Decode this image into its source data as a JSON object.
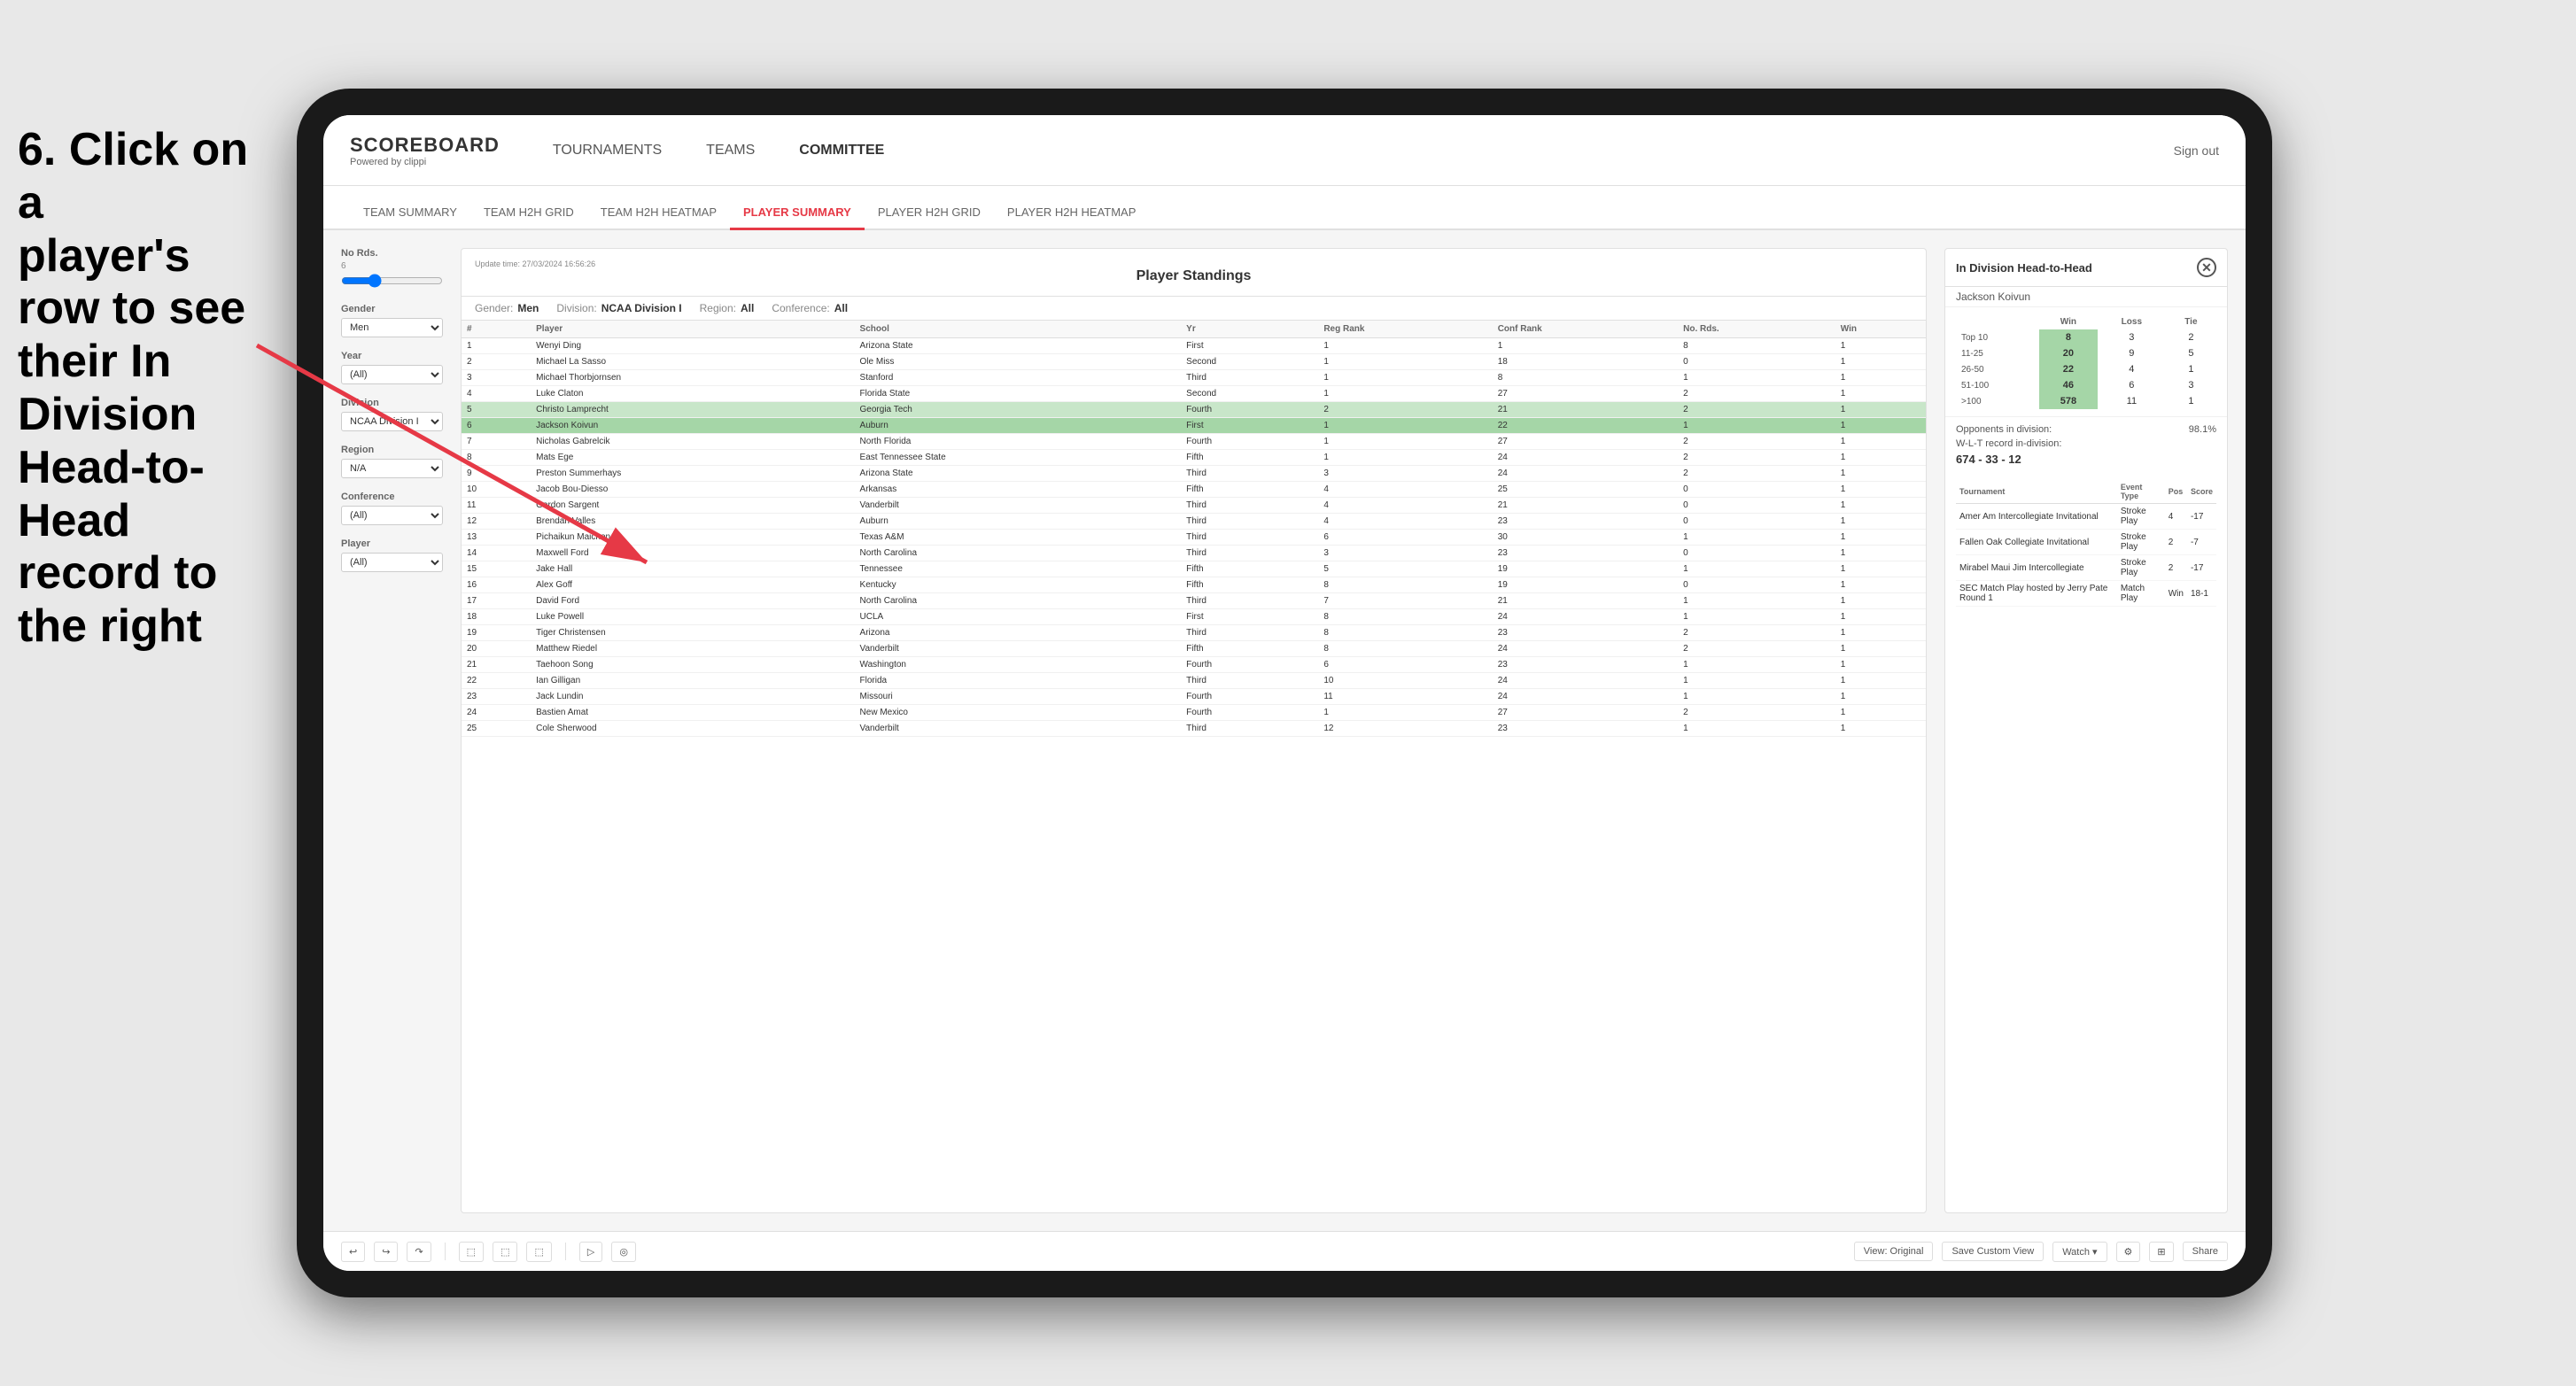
{
  "instruction": {
    "line1": "6. Click on a",
    "line2": "player's row to see",
    "line3": "their In Division",
    "line4": "Head-to-Head",
    "line5": "record to the right"
  },
  "nav": {
    "logo": "SCOREBOARD",
    "logo_sub": "Powered by clippi",
    "items": [
      "TOURNAMENTS",
      "TEAMS",
      "COMMITTEE"
    ],
    "sign_out": "Sign out"
  },
  "sub_nav": {
    "items": [
      "TEAM SUMMARY",
      "TEAM H2H GRID",
      "TEAM H2H HEATMAP",
      "PLAYER SUMMARY",
      "PLAYER H2H GRID",
      "PLAYER H2H HEATMAP"
    ],
    "active": "PLAYER SUMMARY"
  },
  "standings": {
    "title": "Player Standings",
    "update_time": "Update time:",
    "update_date": "27/03/2024 16:56:26",
    "filters": {
      "gender_label": "Gender:",
      "gender_value": "Men",
      "division_label": "Division:",
      "division_value": "NCAA Division I",
      "region_label": "Region:",
      "region_value": "All",
      "conference_label": "Conference:",
      "conference_value": "All"
    },
    "columns": [
      "#",
      "Player",
      "School",
      "Yr",
      "Reg Rank",
      "Conf Rank",
      "No. Rds.",
      "Win"
    ],
    "players": [
      {
        "num": 1,
        "name": "Wenyi Ding",
        "school": "Arizona State",
        "yr": "First",
        "reg": 1,
        "conf": 1,
        "rds": 8,
        "win": 1
      },
      {
        "num": 2,
        "name": "Michael La Sasso",
        "school": "Ole Miss",
        "yr": "Second",
        "reg": 1,
        "conf": 18,
        "rds": 0,
        "win": 1
      },
      {
        "num": 3,
        "name": "Michael Thorbjornsen",
        "school": "Stanford",
        "yr": "Third",
        "reg": 1,
        "conf": 8,
        "rds": 1,
        "win": 1
      },
      {
        "num": 4,
        "name": "Luke Claton",
        "school": "Florida State",
        "yr": "Second",
        "reg": 1,
        "conf": 27,
        "rds": 2,
        "win": 1
      },
      {
        "num": 5,
        "name": "Christo Lamprecht",
        "school": "Georgia Tech",
        "yr": "Fourth",
        "reg": 2,
        "conf": 21,
        "rds": 2,
        "win": 1
      },
      {
        "num": 6,
        "name": "Jackson Koivun",
        "school": "Auburn",
        "yr": "First",
        "reg": 1,
        "conf": 22,
        "rds": 1,
        "win": 1,
        "selected": true
      },
      {
        "num": 7,
        "name": "Nicholas Gabrelcik",
        "school": "North Florida",
        "yr": "Fourth",
        "reg": 1,
        "conf": 27,
        "rds": 2,
        "win": 1
      },
      {
        "num": 8,
        "name": "Mats Ege",
        "school": "East Tennessee State",
        "yr": "Fifth",
        "reg": 1,
        "conf": 24,
        "rds": 2,
        "win": 1
      },
      {
        "num": 9,
        "name": "Preston Summerhays",
        "school": "Arizona State",
        "yr": "Third",
        "reg": 3,
        "conf": 24,
        "rds": 2,
        "win": 1
      },
      {
        "num": 10,
        "name": "Jacob Bou-Diesso",
        "school": "Arkansas",
        "yr": "Fifth",
        "reg": 4,
        "conf": 25,
        "rds": 0,
        "win": 1
      },
      {
        "num": 11,
        "name": "Gordon Sargent",
        "school": "Vanderbilt",
        "yr": "Third",
        "reg": 4,
        "conf": 21,
        "rds": 0,
        "win": 1
      },
      {
        "num": 12,
        "name": "Brendan Valles",
        "school": "Auburn",
        "yr": "Third",
        "reg": 4,
        "conf": 23,
        "rds": 0,
        "win": 1
      },
      {
        "num": 13,
        "name": "Pichaikun Maichon",
        "school": "Texas A&M",
        "yr": "Third",
        "reg": 6,
        "conf": 30,
        "rds": 1,
        "win": 1
      },
      {
        "num": 14,
        "name": "Maxwell Ford",
        "school": "North Carolina",
        "yr": "Third",
        "reg": 3,
        "conf": 23,
        "rds": 0,
        "win": 1
      },
      {
        "num": 15,
        "name": "Jake Hall",
        "school": "Tennessee",
        "yr": "Fifth",
        "reg": 5,
        "conf": 19,
        "rds": 1,
        "win": 1
      },
      {
        "num": 16,
        "name": "Alex Goff",
        "school": "Kentucky",
        "yr": "Fifth",
        "reg": 8,
        "conf": 19,
        "rds": 0,
        "win": 1
      },
      {
        "num": 17,
        "name": "David Ford",
        "school": "North Carolina",
        "yr": "Third",
        "reg": 7,
        "conf": 21,
        "rds": 1,
        "win": 1
      },
      {
        "num": 18,
        "name": "Luke Powell",
        "school": "UCLA",
        "yr": "First",
        "reg": 8,
        "conf": 24,
        "rds": 1,
        "win": 1
      },
      {
        "num": 19,
        "name": "Tiger Christensen",
        "school": "Arizona",
        "yr": "Third",
        "reg": 8,
        "conf": 23,
        "rds": 2,
        "win": 1
      },
      {
        "num": 20,
        "name": "Matthew Riedel",
        "school": "Vanderbilt",
        "yr": "Fifth",
        "reg": 8,
        "conf": 24,
        "rds": 2,
        "win": 1
      },
      {
        "num": 21,
        "name": "Taehoon Song",
        "school": "Washington",
        "yr": "Fourth",
        "reg": 6,
        "conf": 23,
        "rds": 1,
        "win": 1
      },
      {
        "num": 22,
        "name": "Ian Gilligan",
        "school": "Florida",
        "yr": "Third",
        "reg": 10,
        "conf": 24,
        "rds": 1,
        "win": 1
      },
      {
        "num": 23,
        "name": "Jack Lundin",
        "school": "Missouri",
        "yr": "Fourth",
        "reg": 11,
        "conf": 24,
        "rds": 1,
        "win": 1
      },
      {
        "num": 24,
        "name": "Bastien Amat",
        "school": "New Mexico",
        "yr": "Fourth",
        "reg": 1,
        "conf": 27,
        "rds": 2,
        "win": 1
      },
      {
        "num": 25,
        "name": "Cole Sherwood",
        "school": "Vanderbilt",
        "yr": "Third",
        "reg": 12,
        "conf": 23,
        "rds": 1,
        "win": 1
      }
    ]
  },
  "sidebar_filters": {
    "no_rds_label": "No Rds.",
    "no_rds_min": 6,
    "no_rds_max": 12,
    "gender_label": "Gender",
    "gender_value": "Men",
    "year_label": "Year",
    "year_value": "(All)",
    "division_label": "Division",
    "division_value": "NCAA Division I",
    "region_label": "Region",
    "region_value": "N/A",
    "conference_label": "Conference",
    "conference_value": "(All)",
    "player_label": "Player",
    "player_value": "(All)"
  },
  "h2h": {
    "title": "In Division Head-to-Head",
    "player_name": "Jackson Koivun",
    "table_headers": [
      "",
      "Win",
      "Loss",
      "Tie"
    ],
    "rows": [
      {
        "range": "Top 10",
        "win": 8,
        "loss": 3,
        "tie": 2
      },
      {
        "range": "11-25",
        "win": 20,
        "loss": 9,
        "tie": 5
      },
      {
        "range": "26-50",
        "win": 22,
        "loss": 4,
        "tie": 1
      },
      {
        "range": "51-100",
        "win": 46,
        "loss": 6,
        "tie": 3
      },
      {
        "range": ">100",
        "win": 578,
        "loss": 11,
        "tie": 1
      }
    ],
    "opponents_label": "Opponents in division:",
    "opponents_value": "98.1%",
    "wlt_label": "W-L-T record in-division:",
    "wlt_value": "674 - 33 - 12",
    "tournament_columns": [
      "Tournament",
      "Event Type",
      "Pos",
      "Score"
    ],
    "tournaments": [
      {
        "name": "Amer Am Intercollegiate Invitational",
        "type": "Stroke Play",
        "pos": 4,
        "score": -17
      },
      {
        "name": "Fallen Oak Collegiate Invitational",
        "type": "Stroke Play",
        "pos": 2,
        "score": -7
      },
      {
        "name": "Mirabel Maui Jim Intercollegiate",
        "type": "Stroke Play",
        "pos": 2,
        "score": -17
      },
      {
        "name": "SEC Match Play hosted by Jerry Pate Round 1",
        "type": "Match Play",
        "pos": "Win",
        "score": "18-1"
      }
    ]
  },
  "toolbar": {
    "buttons": [
      "←",
      "→",
      "↷",
      "⬚",
      "⬚",
      "⬚",
      "▷",
      "+",
      "◎"
    ],
    "view_original": "View: Original",
    "save_custom": "Save Custom View",
    "watch": "Watch ▾",
    "share": "Share"
  }
}
